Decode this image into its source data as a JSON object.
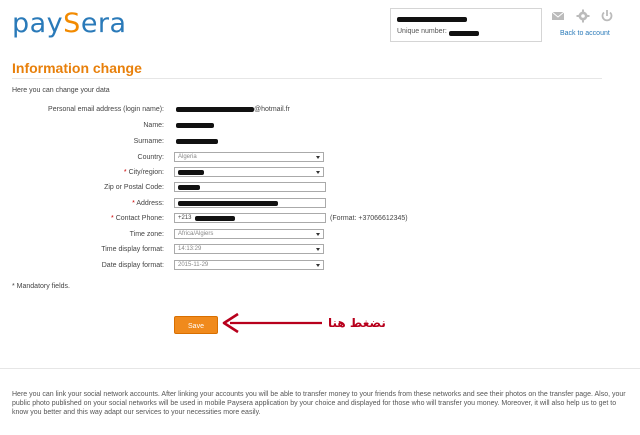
{
  "header": {
    "logo_left": "pay",
    "logo_s": "S",
    "logo_right": "era",
    "unique_number_label": "Unique number:",
    "back_link": "Back to account"
  },
  "page": {
    "title": "Information change",
    "intro": "Here you can change your data"
  },
  "form": {
    "email_label": "Personal email address (login name):",
    "email_suffix": "@hotmail.fr",
    "name_label": "Name:",
    "surname_label": "Surname:",
    "country_label": "Country:",
    "country_value": "Algeria",
    "city_label": "City/region:",
    "zip_label": "Zip or Postal Code:",
    "address_label": "Address:",
    "phone_label": "Contact Phone:",
    "phone_prefix": "+213",
    "phone_hint": "(Format: +37066612345)",
    "timezone_label": "Time zone:",
    "timezone_value": "Africa/Algiers",
    "timeformat_label": "Time display format:",
    "timeformat_value": "14:13:29",
    "dateformat_label": "Date display format:",
    "dateformat_value": "2015-11-29",
    "required_mark": "*",
    "mandatory_note": "* Mandatory fields.",
    "save_label": "Save"
  },
  "annotation": {
    "text": "نضغط هنا",
    "color": "#b8001c"
  },
  "footer": {
    "social_text": "Here you can link your social network accounts. After linking your accounts you will be able to transfer money to your friends from these networks and see their photos on the transfer page. Also, your public photo published on your social networks will be used in mobile Paysera application by your choice and displayed for those who will transfer you money. Moreover, it will also help us to get to know you better and this way adapt our services to your necessities more easily."
  },
  "colors": {
    "accent": "#e8800b",
    "brand_blue": "#2a7ab9",
    "button": "#f08a1c"
  },
  "icons": [
    "mail-icon",
    "gear-icon",
    "power-icon",
    "arrow-annotation"
  ]
}
